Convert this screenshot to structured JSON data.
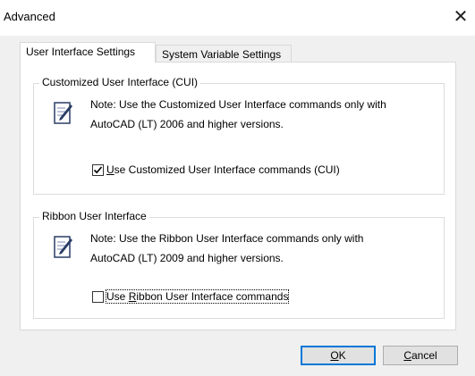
{
  "window": {
    "title": "Advanced",
    "close_glyph": "✕"
  },
  "tabs": [
    {
      "label": "User Interface Settings",
      "active": true
    },
    {
      "label": "System Variable Settings",
      "active": false
    }
  ],
  "cui_group": {
    "legend": "Customized User Interface (CUI)",
    "note_line1": "Note: Use the Customized User Interface commands only with",
    "note_line2": "AutoCAD (LT) 2006 and higher versions.",
    "checkbox_mnemonic": "U",
    "checkbox_rest": "se Customized User Interface commands (CUI)",
    "checked": true
  },
  "ribbon_group": {
    "legend": "Ribbon User Interface",
    "note_line1": "Note: Use the Ribbon User Interface commands only with",
    "note_line2": "AutoCAD (LT) 2009 and higher versions.",
    "checkbox_prefix": "Use ",
    "checkbox_mnemonic": "R",
    "checkbox_rest": "ibbon User Interface commands",
    "checked": false
  },
  "buttons": {
    "ok_mnemonic": "O",
    "ok_rest": "K",
    "cancel_mnemonic": "C",
    "cancel_rest": "ancel"
  },
  "colors": {
    "accent": "#0078d7",
    "dialog_bg": "#f0f0f0",
    "panel_bg": "#ffffff"
  },
  "icons": {
    "note": "notepad-pencil-icon",
    "check": "checkmark-icon",
    "close": "close-icon"
  }
}
